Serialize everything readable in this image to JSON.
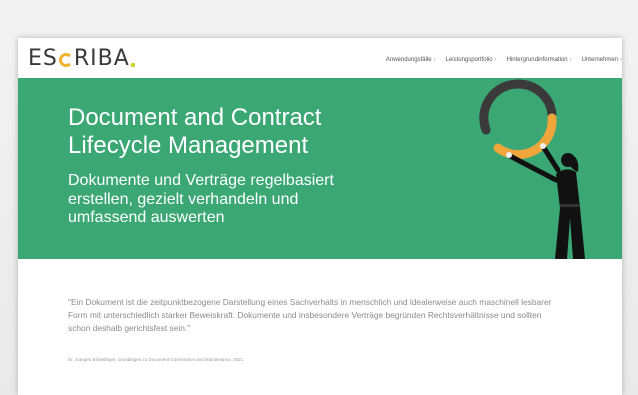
{
  "header": {
    "logo_pre": "ES",
    "logo_post": "RIBA",
    "nav": [
      {
        "label": "Anwendungsfälle",
        "chevron": "›"
      },
      {
        "label": "Leistungsportfolio",
        "chevron": "›"
      },
      {
        "label": "Hintergrundinformation",
        "chevron": "›"
      },
      {
        "label": "Unternehmen",
        "chevron": "›"
      }
    ]
  },
  "hero": {
    "title": "Document and Contract Lifecycle Management",
    "subtitle": "Dokumente und Verträge regelbasiert erstellen, gezielt verhandeln und umfassend auswerten",
    "background": "#3aa775"
  },
  "quote": {
    "text": "\"Ein Dokument ist die zeitpunktbezogene Darstellung eines Sachverhalts in menschlich und idealerweise auch maschinell lesbarer Form mit unterschiedlich starker Beweiskraft. Dokumente und insbesondere Verträge begründen Rechtsverhältnisse und sollten schon deshalb gerichtsfest sein.\"",
    "citation": "Dr. Juergen Erbeldinger, Grundlagen zu Document Governance and Maintenance, 2021"
  },
  "colors": {
    "accent_green": "#3aa775",
    "ring_orange": "#f0a63a",
    "ring_dark": "#3a3a3a",
    "logo_yellow": "#f0b432"
  }
}
